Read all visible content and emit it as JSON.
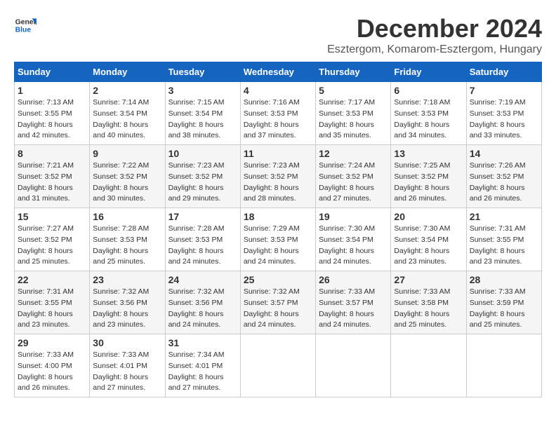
{
  "header": {
    "logo_general": "General",
    "logo_blue": "Blue",
    "month_title": "December 2024",
    "location": "Esztergom, Komarom-Esztergom, Hungary"
  },
  "weekdays": [
    "Sunday",
    "Monday",
    "Tuesday",
    "Wednesday",
    "Thursday",
    "Friday",
    "Saturday"
  ],
  "weeks": [
    [
      {
        "day": "1",
        "sunrise": "7:13 AM",
        "sunset": "3:55 PM",
        "daylight": "8 hours and 42 minutes."
      },
      {
        "day": "2",
        "sunrise": "7:14 AM",
        "sunset": "3:54 PM",
        "daylight": "8 hours and 40 minutes."
      },
      {
        "day": "3",
        "sunrise": "7:15 AM",
        "sunset": "3:54 PM",
        "daylight": "8 hours and 38 minutes."
      },
      {
        "day": "4",
        "sunrise": "7:16 AM",
        "sunset": "3:53 PM",
        "daylight": "8 hours and 37 minutes."
      },
      {
        "day": "5",
        "sunrise": "7:17 AM",
        "sunset": "3:53 PM",
        "daylight": "8 hours and 35 minutes."
      },
      {
        "day": "6",
        "sunrise": "7:18 AM",
        "sunset": "3:53 PM",
        "daylight": "8 hours and 34 minutes."
      },
      {
        "day": "7",
        "sunrise": "7:19 AM",
        "sunset": "3:53 PM",
        "daylight": "8 hours and 33 minutes."
      }
    ],
    [
      {
        "day": "8",
        "sunrise": "7:21 AM",
        "sunset": "3:52 PM",
        "daylight": "8 hours and 31 minutes."
      },
      {
        "day": "9",
        "sunrise": "7:22 AM",
        "sunset": "3:52 PM",
        "daylight": "8 hours and 30 minutes."
      },
      {
        "day": "10",
        "sunrise": "7:23 AM",
        "sunset": "3:52 PM",
        "daylight": "8 hours and 29 minutes."
      },
      {
        "day": "11",
        "sunrise": "7:23 AM",
        "sunset": "3:52 PM",
        "daylight": "8 hours and 28 minutes."
      },
      {
        "day": "12",
        "sunrise": "7:24 AM",
        "sunset": "3:52 PM",
        "daylight": "8 hours and 27 minutes."
      },
      {
        "day": "13",
        "sunrise": "7:25 AM",
        "sunset": "3:52 PM",
        "daylight": "8 hours and 26 minutes."
      },
      {
        "day": "14",
        "sunrise": "7:26 AM",
        "sunset": "3:52 PM",
        "daylight": "8 hours and 26 minutes."
      }
    ],
    [
      {
        "day": "15",
        "sunrise": "7:27 AM",
        "sunset": "3:52 PM",
        "daylight": "8 hours and 25 minutes."
      },
      {
        "day": "16",
        "sunrise": "7:28 AM",
        "sunset": "3:53 PM",
        "daylight": "8 hours and 25 minutes."
      },
      {
        "day": "17",
        "sunrise": "7:28 AM",
        "sunset": "3:53 PM",
        "daylight": "8 hours and 24 minutes."
      },
      {
        "day": "18",
        "sunrise": "7:29 AM",
        "sunset": "3:53 PM",
        "daylight": "8 hours and 24 minutes."
      },
      {
        "day": "19",
        "sunrise": "7:30 AM",
        "sunset": "3:54 PM",
        "daylight": "8 hours and 24 minutes."
      },
      {
        "day": "20",
        "sunrise": "7:30 AM",
        "sunset": "3:54 PM",
        "daylight": "8 hours and 23 minutes."
      },
      {
        "day": "21",
        "sunrise": "7:31 AM",
        "sunset": "3:55 PM",
        "daylight": "8 hours and 23 minutes."
      }
    ],
    [
      {
        "day": "22",
        "sunrise": "7:31 AM",
        "sunset": "3:55 PM",
        "daylight": "8 hours and 23 minutes."
      },
      {
        "day": "23",
        "sunrise": "7:32 AM",
        "sunset": "3:56 PM",
        "daylight": "8 hours and 23 minutes."
      },
      {
        "day": "24",
        "sunrise": "7:32 AM",
        "sunset": "3:56 PM",
        "daylight": "8 hours and 24 minutes."
      },
      {
        "day": "25",
        "sunrise": "7:32 AM",
        "sunset": "3:57 PM",
        "daylight": "8 hours and 24 minutes."
      },
      {
        "day": "26",
        "sunrise": "7:33 AM",
        "sunset": "3:57 PM",
        "daylight": "8 hours and 24 minutes."
      },
      {
        "day": "27",
        "sunrise": "7:33 AM",
        "sunset": "3:58 PM",
        "daylight": "8 hours and 25 minutes."
      },
      {
        "day": "28",
        "sunrise": "7:33 AM",
        "sunset": "3:59 PM",
        "daylight": "8 hours and 25 minutes."
      }
    ],
    [
      {
        "day": "29",
        "sunrise": "7:33 AM",
        "sunset": "4:00 PM",
        "daylight": "8 hours and 26 minutes."
      },
      {
        "day": "30",
        "sunrise": "7:33 AM",
        "sunset": "4:01 PM",
        "daylight": "8 hours and 27 minutes."
      },
      {
        "day": "31",
        "sunrise": "7:34 AM",
        "sunset": "4:01 PM",
        "daylight": "8 hours and 27 minutes."
      },
      null,
      null,
      null,
      null
    ]
  ],
  "labels": {
    "sunrise": "Sunrise:",
    "sunset": "Sunset:",
    "daylight": "Daylight:"
  }
}
